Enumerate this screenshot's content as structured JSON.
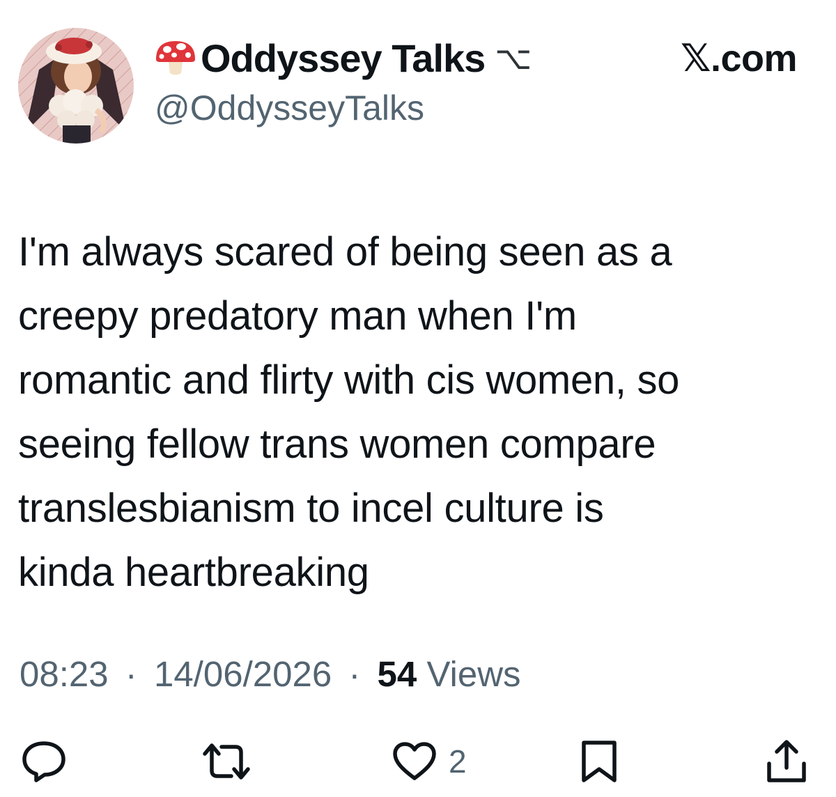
{
  "account": {
    "emoji": "mushroom",
    "display_name": "Oddyssey Talks",
    "name_glyph": "⌥",
    "handle": "@OddysseyTalks",
    "avatar": "avatar-image"
  },
  "site_label": "𝕏.com",
  "tweet": {
    "lines": [
      "I'm always scared of being seen as a",
      "creepy predatory man when I'm",
      "romantic and flirty with cis women, so",
      "seeing fellow trans women compare",
      "translesbianism to incel culture is",
      "kinda heartbreaking"
    ]
  },
  "meta": {
    "time": "08:23",
    "separator": "·",
    "date": "14/06/2026",
    "views_count": "54",
    "views_label": "Views"
  },
  "actions": {
    "reply_icon": "reply-icon",
    "repost_icon": "repost-icon",
    "like_icon": "heart-icon",
    "like_count": "2",
    "bookmark_icon": "bookmark-icon",
    "share_icon": "share-icon"
  },
  "colors": {
    "text_primary": "#0f1419",
    "text_secondary": "#536471",
    "mushroom_red": "#e0353a"
  }
}
